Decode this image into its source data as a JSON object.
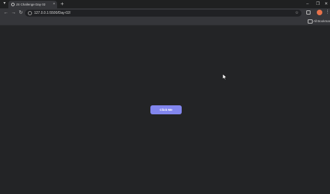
{
  "browser": {
    "tab": {
      "title": "JS Challenge Day 02",
      "close": "×"
    },
    "new_tab": "+",
    "window_controls": {
      "minimize": "–",
      "maximize": "❐",
      "close": "✕"
    },
    "toolbar": {
      "back": "←",
      "forward": "→",
      "reload": "↻",
      "url": "127.0.0.1:5500/Day-02/",
      "star": "☆",
      "menu": "⋮"
    },
    "bookmarks": {
      "label": "All Bookmarks"
    }
  },
  "page": {
    "button_label": "Click Me"
  },
  "colors": {
    "background": "#232426",
    "button": "#8286ee"
  },
  "icons": [
    "tab-menu-icon",
    "globe-icon",
    "site-info-icon",
    "star-icon",
    "extensions-icon",
    "profile-avatar-icon",
    "kebab-menu-icon",
    "folder-icon",
    "cursor-icon"
  ]
}
